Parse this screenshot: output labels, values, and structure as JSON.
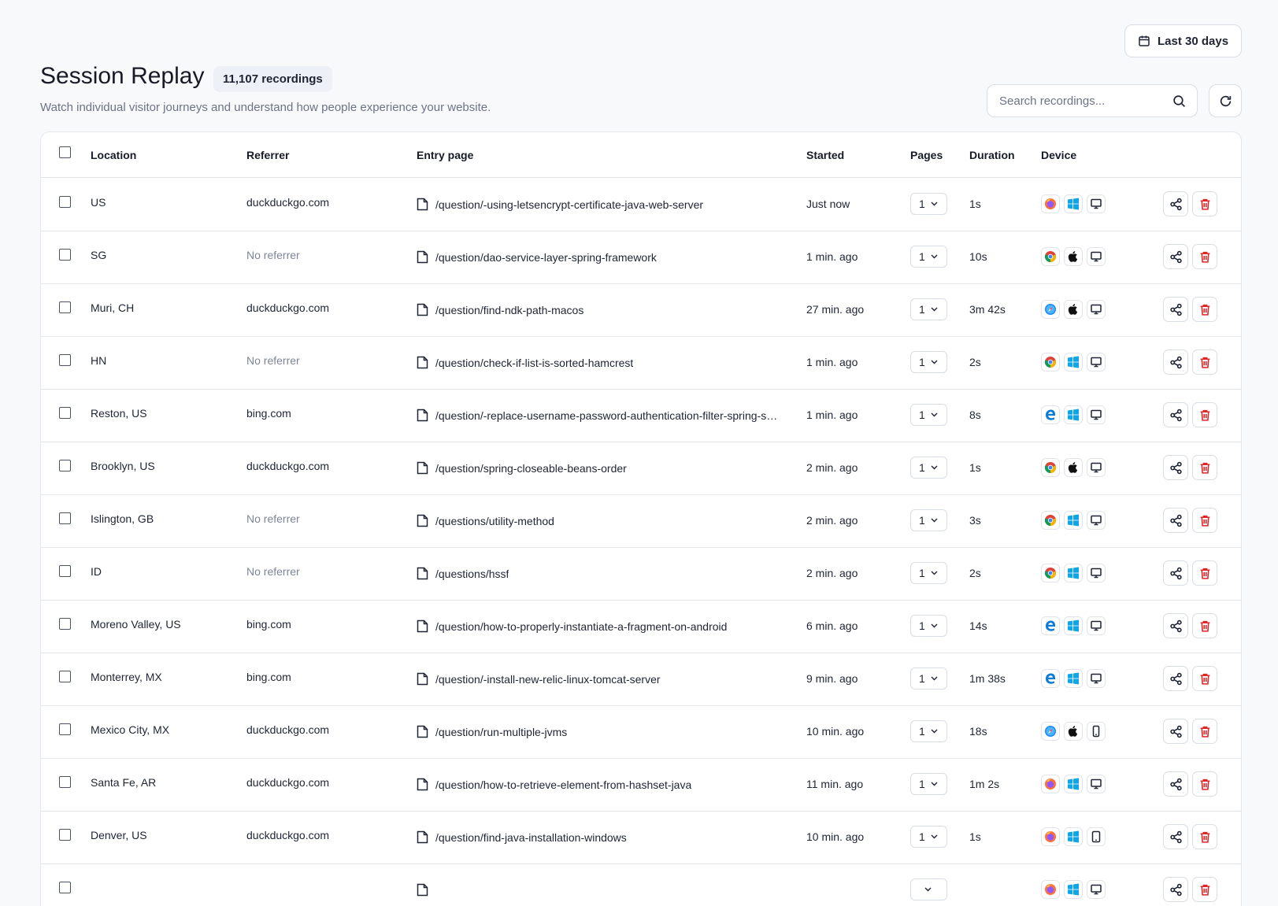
{
  "header": {
    "title": "Session Replay",
    "count_badge": "11,107 recordings",
    "subtitle": "Watch individual visitor journeys and understand how people experience your website.",
    "date_range": "Last 30 days",
    "search_placeholder": "Search recordings..."
  },
  "table": {
    "columns": {
      "location": "Location",
      "referrer": "Referrer",
      "entry_page": "Entry page",
      "started": "Started",
      "pages": "Pages",
      "duration": "Duration",
      "device": "Device"
    },
    "rows": [
      {
        "location": "US",
        "referrer": "duckduckgo.com",
        "entry_page": "/question/-using-letsencrypt-certificate-java-web-server",
        "started": "Just now",
        "pages": "1",
        "duration": "1s",
        "browser": "firefox",
        "os": "windows",
        "device": "desktop"
      },
      {
        "location": "SG",
        "referrer": "No referrer",
        "entry_page": "/question/dao-service-layer-spring-framework",
        "started": "1 min. ago",
        "pages": "1",
        "duration": "10s",
        "browser": "chrome",
        "os": "apple",
        "device": "desktop"
      },
      {
        "location": "Muri, CH",
        "referrer": "duckduckgo.com",
        "entry_page": "/question/find-ndk-path-macos",
        "started": "27 min. ago",
        "pages": "1",
        "duration": "3m 42s",
        "browser": "safari",
        "os": "apple",
        "device": "desktop"
      },
      {
        "location": "HN",
        "referrer": "No referrer",
        "entry_page": "/question/check-if-list-is-sorted-hamcrest",
        "started": "1 min. ago",
        "pages": "1",
        "duration": "2s",
        "browser": "chrome",
        "os": "windows",
        "device": "desktop"
      },
      {
        "location": "Reston, US",
        "referrer": "bing.com",
        "entry_page": "/question/-replace-username-password-authentication-filter-spring-security",
        "started": "1 min. ago",
        "pages": "1",
        "duration": "8s",
        "browser": "edge",
        "os": "windows",
        "device": "desktop"
      },
      {
        "location": "Brooklyn, US",
        "referrer": "duckduckgo.com",
        "entry_page": "/question/spring-closeable-beans-order",
        "started": "2 min. ago",
        "pages": "1",
        "duration": "1s",
        "browser": "chrome",
        "os": "apple",
        "device": "desktop"
      },
      {
        "location": "Islington, GB",
        "referrer": "No referrer",
        "entry_page": "/questions/utility-method",
        "started": "2 min. ago",
        "pages": "1",
        "duration": "3s",
        "browser": "chrome",
        "os": "windows",
        "device": "desktop"
      },
      {
        "location": "ID",
        "referrer": "No referrer",
        "entry_page": "/questions/hssf",
        "started": "2 min. ago",
        "pages": "1",
        "duration": "2s",
        "browser": "chrome",
        "os": "windows",
        "device": "desktop"
      },
      {
        "location": "Moreno Valley, US",
        "referrer": "bing.com",
        "entry_page": "/question/how-to-properly-instantiate-a-fragment-on-android",
        "started": "6 min. ago",
        "pages": "1",
        "duration": "14s",
        "browser": "edge",
        "os": "windows",
        "device": "desktop"
      },
      {
        "location": "Monterrey, MX",
        "referrer": "bing.com",
        "entry_page": "/question/-install-new-relic-linux-tomcat-server",
        "started": "9 min. ago",
        "pages": "1",
        "duration": "1m 38s",
        "browser": "edge",
        "os": "windows",
        "device": "desktop"
      },
      {
        "location": "Mexico City, MX",
        "referrer": "duckduckgo.com",
        "entry_page": "/question/run-multiple-jvms",
        "started": "10 min. ago",
        "pages": "1",
        "duration": "18s",
        "browser": "safari",
        "os": "apple",
        "device": "mobile"
      },
      {
        "location": "Santa Fe, AR",
        "referrer": "duckduckgo.com",
        "entry_page": "/question/how-to-retrieve-element-from-hashset-java",
        "started": "11 min. ago",
        "pages": "1",
        "duration": "1m 2s",
        "browser": "firefox",
        "os": "windows",
        "device": "desktop"
      },
      {
        "location": "Denver, US",
        "referrer": "duckduckgo.com",
        "entry_page": "/question/find-java-installation-windows",
        "started": "10 min. ago",
        "pages": "1",
        "duration": "1s",
        "browser": "firefox",
        "os": "windows",
        "device": "tablet"
      },
      {
        "location": "",
        "referrer": "",
        "entry_page": "",
        "started": "",
        "pages": "",
        "duration": "",
        "browser": "firefox",
        "os": "windows",
        "device": "desktop"
      }
    ]
  },
  "colors": {
    "accent_danger": "#dc2626",
    "border": "#e4e7ec",
    "muted_text": "#7d8596"
  }
}
